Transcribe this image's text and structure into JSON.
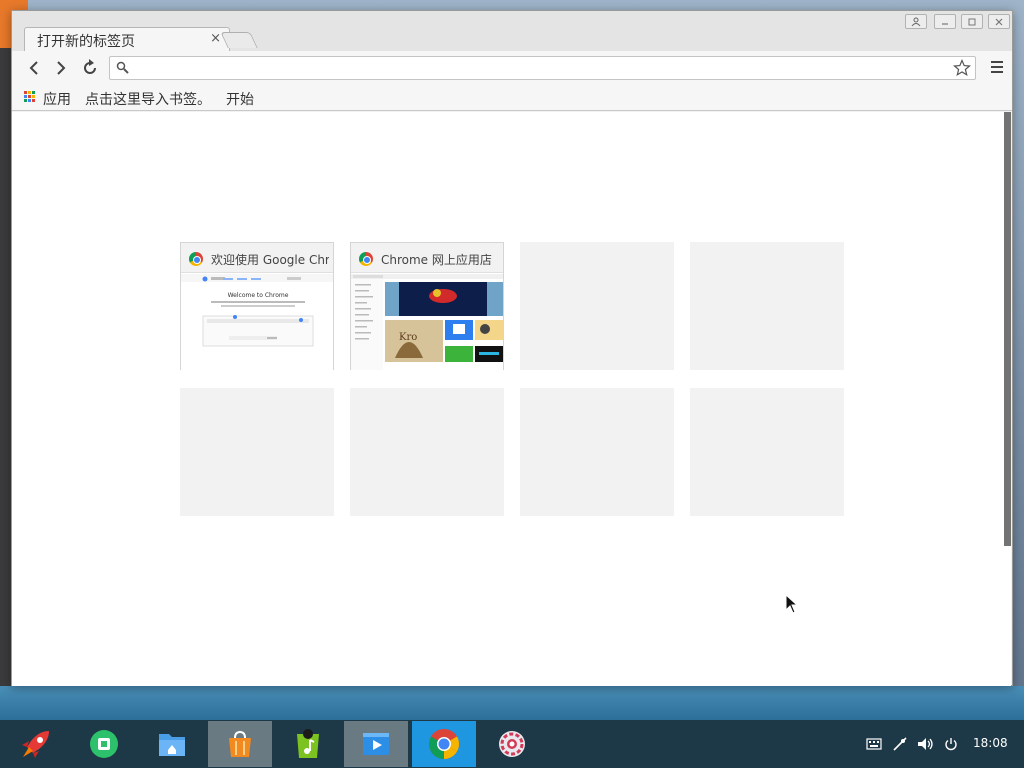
{
  "window": {
    "tab_title": "打开新的标签页",
    "tab_close": "×"
  },
  "toolbar": {
    "omnibox_value": "",
    "omnibox_placeholder": ""
  },
  "bookmarks": {
    "apps_label": "应用",
    "import_text": "点击这里导入书签。",
    "start_link": "开始"
  },
  "most_visited": [
    {
      "title": "欢迎使用 Google Chrome",
      "thumb": "welcome",
      "thumb_heading": "Welcome to Chrome"
    },
    {
      "title": "Chrome 网上应用店",
      "thumb": "webstore"
    },
    {
      "title": "",
      "thumb": ""
    },
    {
      "title": "",
      "thumb": ""
    },
    {
      "title": "",
      "thumb": ""
    },
    {
      "title": "",
      "thumb": ""
    },
    {
      "title": "",
      "thumb": ""
    },
    {
      "title": "",
      "thumb": ""
    }
  ],
  "taskbar": {
    "apps": [
      {
        "name": "launcher",
        "icon": "rocket-icon",
        "state": "normal"
      },
      {
        "name": "deepin-store",
        "icon": "store-bag-icon",
        "state": "normal"
      },
      {
        "name": "file-manager",
        "icon": "folder-icon",
        "state": "normal"
      },
      {
        "name": "app-store",
        "icon": "shopping-bag-icon",
        "state": "active"
      },
      {
        "name": "music",
        "icon": "music-icon",
        "state": "normal"
      },
      {
        "name": "video",
        "icon": "video-icon",
        "state": "active"
      },
      {
        "name": "chrome",
        "icon": "chrome-icon",
        "state": "focused"
      },
      {
        "name": "settings",
        "icon": "settings-icon",
        "state": "normal"
      }
    ],
    "clock": "18:08"
  },
  "colors": {
    "taskbar_bg": "#1d3846",
    "focused_app_bg": "#1e96e0",
    "tile_placeholder": "#f2f2f2"
  }
}
